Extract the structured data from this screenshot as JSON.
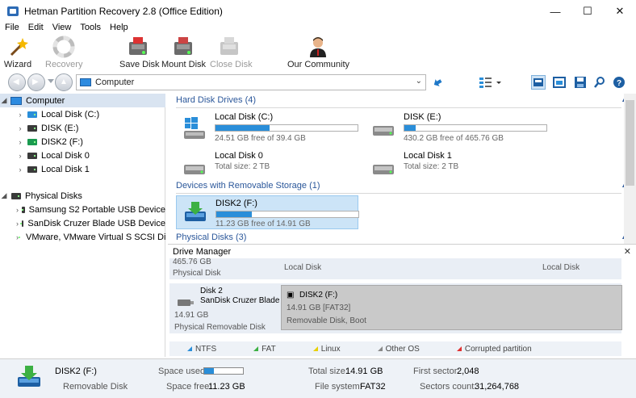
{
  "window": {
    "title": "Hetman Partition Recovery 2.8 (Office Edition)",
    "minimize": "—",
    "maximize": "☐",
    "close": "✕"
  },
  "menu": [
    "File",
    "Edit",
    "View",
    "Tools",
    "Help"
  ],
  "toolbar": {
    "wizard": "Wizard",
    "recovery": "Recovery",
    "save_disk": "Save Disk",
    "mount_disk": "Mount Disk",
    "close_disk": "Close Disk",
    "community": "Our Community"
  },
  "address": {
    "value": "Computer"
  },
  "tree": {
    "computer": "Computer",
    "computer_items": [
      "Local Disk (C:)",
      "DISK (E:)",
      "DISK2 (F:)",
      "Local Disk 0",
      "Local Disk 1"
    ],
    "physical": "Physical Disks",
    "physical_items": [
      "Samsung S2 Portable USB Device",
      "SanDisk Cruzer Blade USB Device",
      "VMware, VMware Virtual S SCSI Di"
    ]
  },
  "sections": {
    "hdd": "Hard Disk Drives (4)",
    "removable": "Devices with Removable Storage (1)",
    "physical": "Physical Disks (3)"
  },
  "drives": {
    "c": {
      "name": "Local Disk (C:)",
      "info": "24.51 GB free of 39.4 GB",
      "used_fraction": 0.38
    },
    "e": {
      "name": "DISK (E:)",
      "info": "430.2 GB free of 465.76 GB",
      "used_fraction": 0.08
    },
    "ld0": {
      "name": "Local Disk 0",
      "info": "Total size: 2 TB"
    },
    "ld1": {
      "name": "Local Disk 1",
      "info": "Total size: 2 TB"
    },
    "f": {
      "name": "DISK2 (F:)",
      "info": "11.23 GB free of 14.91 GB",
      "used_fraction": 0.25
    }
  },
  "drive_manager": {
    "title": "Drive Manager",
    "close": "✕",
    "row1": {
      "size": "465.76 GB",
      "type": "Physical Disk",
      "part1": "Local Disk",
      "part2": "Local Disk"
    },
    "row2": {
      "disk": "Disk 2",
      "model": "SanDisk Cruzer Blade",
      "size": "14.91 GB",
      "type": "Physical Removable Disk",
      "part_name": "DISK2 (F:)",
      "part_size": "14.91 GB [FAT32]",
      "part_desc": "Removable Disk, Boot"
    },
    "legend": [
      {
        "label": "NTFS",
        "color": "#2a8ed9"
      },
      {
        "label": "FAT",
        "color": "#3cb043"
      },
      {
        "label": "Linux",
        "color": "#e8d000"
      },
      {
        "label": "Other OS",
        "color": "#888888"
      },
      {
        "label": "Corrupted partition",
        "color": "#e03030"
      }
    ]
  },
  "status": {
    "name": "DISK2 (F:)",
    "type": "Removable Disk",
    "space_used_label": "Space used:",
    "space_used_fraction": 0.25,
    "space_free_label": "Space free:",
    "space_free": "11.23 GB",
    "total_label": "Total size:",
    "total": "14.91 GB",
    "fs_label": "File system:",
    "fs": "FAT32",
    "first_sector_label": "First sector:",
    "first_sector": "2,048",
    "sectors_label": "Sectors count:",
    "sectors": "31,264,768"
  }
}
